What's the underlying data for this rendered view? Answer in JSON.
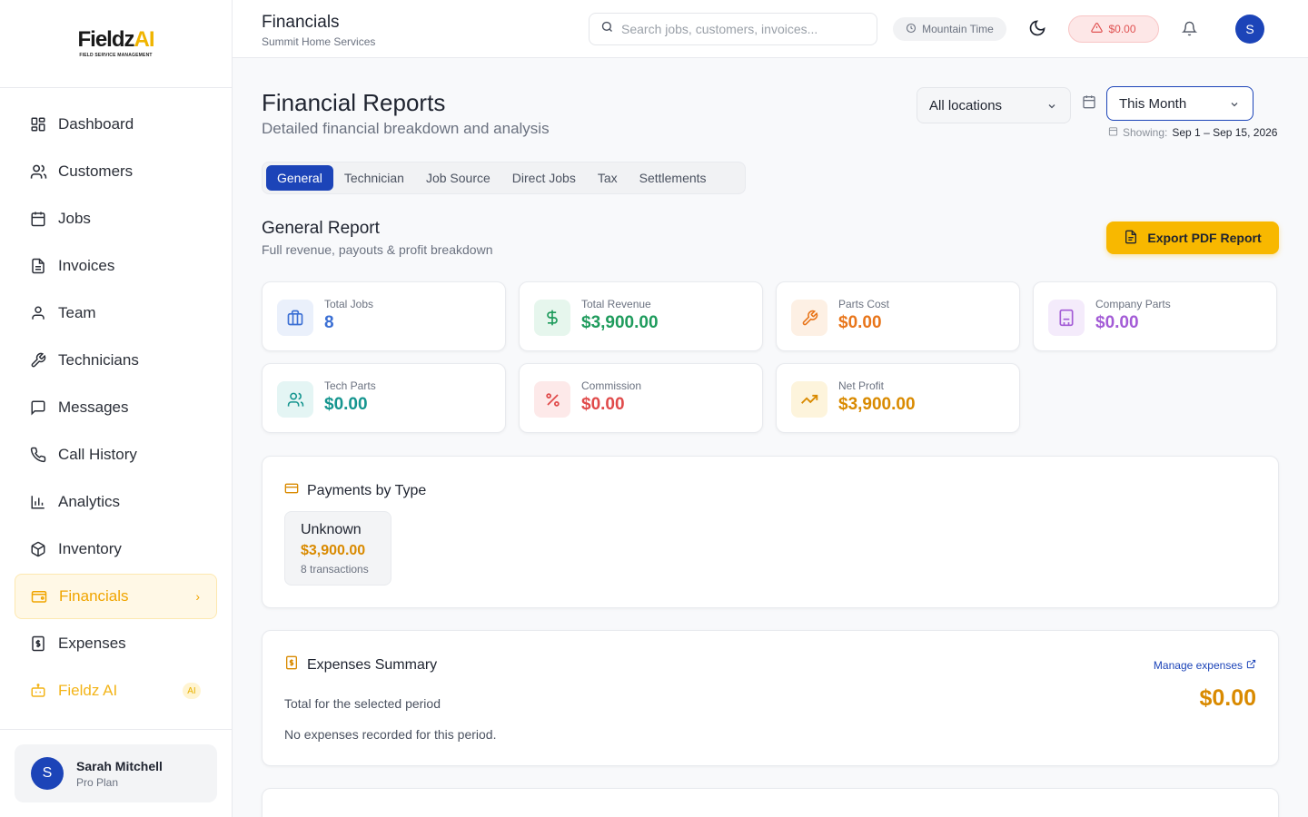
{
  "brand": {
    "name_main": "Fieldz",
    "name_ai": "AI",
    "tagline": "FIELD SERVICE MANAGEMENT"
  },
  "sidebar": {
    "items": [
      {
        "label": "Dashboard",
        "icon": "dashboard-grid-icon"
      },
      {
        "label": "Customers",
        "icon": "users-icon"
      },
      {
        "label": "Jobs",
        "icon": "calendar-icon"
      },
      {
        "label": "Invoices",
        "icon": "file-text-icon"
      },
      {
        "label": "Team",
        "icon": "user-icon"
      },
      {
        "label": "Technicians",
        "icon": "wrench-icon"
      },
      {
        "label": "Messages",
        "icon": "message-square-icon"
      },
      {
        "label": "Call History",
        "icon": "phone-icon"
      },
      {
        "label": "Analytics",
        "icon": "bar-chart-icon"
      },
      {
        "label": "Inventory",
        "icon": "package-icon"
      },
      {
        "label": "Financials",
        "icon": "wallet-icon",
        "active": true
      },
      {
        "label": "Expenses",
        "icon": "receipt-icon"
      },
      {
        "label": "Fieldz AI",
        "icon": "bot-icon",
        "badge": "AI"
      }
    ],
    "user": {
      "initial": "S",
      "name": "Sarah Mitchell",
      "plan": "Pro Plan"
    }
  },
  "header": {
    "title": "Financials",
    "subtitle": "Summit Home Services",
    "search_placeholder": "Search jobs, customers, invoices...",
    "timezone": "Mountain Time",
    "alert_amount": "$0.00",
    "avatar_initial": "S"
  },
  "page": {
    "title": "Financial Reports",
    "subtitle": "Detailed financial breakdown and analysis",
    "location_filter": "All locations",
    "period_filter": "This Month",
    "showing_label": "Showing:",
    "showing_range": "Sep 1 – Sep 15, 2026"
  },
  "tabs": [
    "General",
    "Technician",
    "Job Source",
    "Direct Jobs",
    "Tax",
    "Settlements"
  ],
  "report": {
    "title": "General Report",
    "subtitle": "Full revenue, payouts & profit breakdown",
    "export_label": "Export PDF Report"
  },
  "stats": [
    {
      "label": "Total Jobs",
      "value": "8",
      "color": "#3b6fd4",
      "bg": "#eaf0fb",
      "icon": "briefcase-icon"
    },
    {
      "label": "Total Revenue",
      "value": "$3,900.00",
      "color": "#1e9b5c",
      "bg": "#e6f6ed",
      "icon": "dollar-sign-icon"
    },
    {
      "label": "Parts Cost",
      "value": "$0.00",
      "color": "#e8751a",
      "bg": "#fdf0e4",
      "icon": "wrench-icon"
    },
    {
      "label": "Company Parts",
      "value": "$0.00",
      "color": "#a35bd6",
      "bg": "#f4ebfb",
      "icon": "building-icon"
    },
    {
      "label": "Tech Parts",
      "value": "$0.00",
      "color": "#15958f",
      "bg": "#e4f5f4",
      "icon": "users-icon"
    },
    {
      "label": "Commission",
      "value": "$0.00",
      "color": "#e04a4a",
      "bg": "#fde9e9",
      "icon": "percent-icon"
    },
    {
      "label": "Net Profit",
      "value": "$3,900.00",
      "color": "#d98a00",
      "bg": "#fdf4dc",
      "icon": "trending-up-icon"
    }
  ],
  "payments": {
    "title": "Payments by Type",
    "items": [
      {
        "name": "Unknown",
        "amount": "$3,900.00",
        "count": "8 transactions"
      }
    ]
  },
  "expenses": {
    "title": "Expenses Summary",
    "manage_label": "Manage expenses",
    "total_label": "Total for the selected period",
    "total": "$0.00",
    "empty_text": "No expenses recorded for this period."
  }
}
